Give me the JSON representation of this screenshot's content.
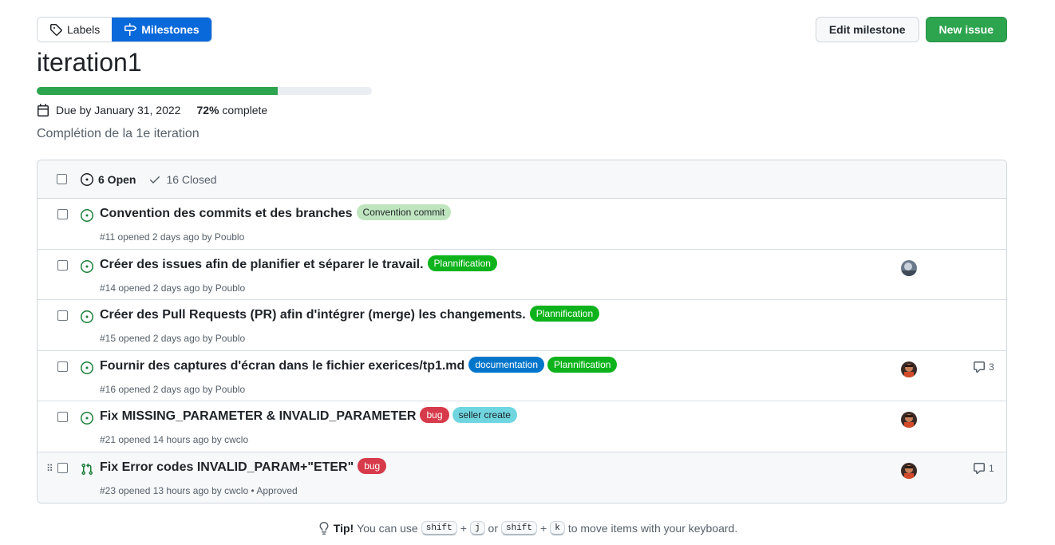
{
  "subnav": {
    "labels": "Labels",
    "milestones": "Milestones"
  },
  "actions": {
    "edit": "Edit milestone",
    "new_issue": "New issue"
  },
  "milestone": {
    "title": "iteration1",
    "progress": 0.72,
    "due": "Due by January 31, 2022",
    "percent": "72%",
    "complete_word": "complete",
    "description": "Complétion de la 1e iteration"
  },
  "header": {
    "open": "6 Open",
    "closed": "16 Closed"
  },
  "issues": [
    {
      "title": "Convention des commits et des branches",
      "labels": [
        {
          "text": "Convention commit",
          "bg": "#bfe5bf",
          "fg": "#1f2328"
        }
      ],
      "meta": "#11 opened 2 days ago by Poublo",
      "assignee": false,
      "comments": ""
    },
    {
      "title": "Créer des issues afin de planifier et séparer le travail.",
      "labels": [
        {
          "text": "Plannification",
          "bg": "#0eb31c",
          "fg": "#ffffff"
        }
      ],
      "meta": "#14 opened 2 days ago by Poublo",
      "assignee": true,
      "comments": ""
    },
    {
      "title": "Créer des Pull Requests (PR) afin d'intégrer (merge) les changements.",
      "labels": [
        {
          "text": "Plannification",
          "bg": "#0eb31c",
          "fg": "#ffffff"
        }
      ],
      "meta": "#15 opened 2 days ago by Poublo",
      "assignee": false,
      "comments": ""
    },
    {
      "title": "Fournir des captures d'écran dans le fichier exerices/tp1.md",
      "labels": [
        {
          "text": "documentation",
          "bg": "#0075ca",
          "fg": "#ffffff"
        },
        {
          "text": "Plannification",
          "bg": "#0eb31c",
          "fg": "#ffffff"
        }
      ],
      "meta": "#16 opened 2 days ago by Poublo",
      "assignee": true,
      "comments": "3"
    },
    {
      "title": "Fix MISSING_PARAMETER & INVALID_PARAMETER",
      "labels": [
        {
          "text": "bug",
          "bg": "#d73a4a",
          "fg": "#ffffff"
        },
        {
          "text": "seller create",
          "bg": "#6fd6e0",
          "fg": "#1f2328"
        }
      ],
      "meta": "#21 opened 14 hours ago by cwclo",
      "assignee": true,
      "comments": ""
    },
    {
      "title": "Fix Error codes INVALID_PARAM+\"ETER\"",
      "labels": [
        {
          "text": "bug",
          "bg": "#d73a4a",
          "fg": "#ffffff"
        }
      ],
      "meta": "#23 opened 13 hours ago by cwclo • Approved",
      "assignee": true,
      "comments": "1",
      "pull_request": true
    }
  ],
  "tip": {
    "lead": "Tip!",
    "text1": "You can use",
    "key_shift": "shift",
    "plus": "+",
    "key_j": "j",
    "or": "or",
    "key_k": "k",
    "text2": "to move items with your keyboard."
  },
  "colors": {
    "accent": "#0969da",
    "success": "#2da44e",
    "open_icon": "#1a7f37"
  }
}
